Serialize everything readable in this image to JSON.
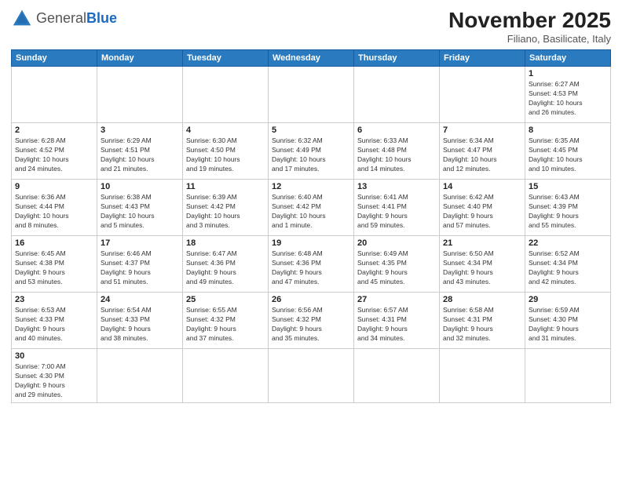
{
  "header": {
    "logo_general": "General",
    "logo_blue": "Blue",
    "month_title": "November 2025",
    "location": "Filiano, Basilicate, Italy"
  },
  "weekdays": [
    "Sunday",
    "Monday",
    "Tuesday",
    "Wednesday",
    "Thursday",
    "Friday",
    "Saturday"
  ],
  "weeks": [
    [
      {
        "day": "",
        "info": ""
      },
      {
        "day": "",
        "info": ""
      },
      {
        "day": "",
        "info": ""
      },
      {
        "day": "",
        "info": ""
      },
      {
        "day": "",
        "info": ""
      },
      {
        "day": "",
        "info": ""
      },
      {
        "day": "1",
        "info": "Sunrise: 6:27 AM\nSunset: 4:53 PM\nDaylight: 10 hours\nand 26 minutes."
      }
    ],
    [
      {
        "day": "2",
        "info": "Sunrise: 6:28 AM\nSunset: 4:52 PM\nDaylight: 10 hours\nand 24 minutes."
      },
      {
        "day": "3",
        "info": "Sunrise: 6:29 AM\nSunset: 4:51 PM\nDaylight: 10 hours\nand 21 minutes."
      },
      {
        "day": "4",
        "info": "Sunrise: 6:30 AM\nSunset: 4:50 PM\nDaylight: 10 hours\nand 19 minutes."
      },
      {
        "day": "5",
        "info": "Sunrise: 6:32 AM\nSunset: 4:49 PM\nDaylight: 10 hours\nand 17 minutes."
      },
      {
        "day": "6",
        "info": "Sunrise: 6:33 AM\nSunset: 4:48 PM\nDaylight: 10 hours\nand 14 minutes."
      },
      {
        "day": "7",
        "info": "Sunrise: 6:34 AM\nSunset: 4:47 PM\nDaylight: 10 hours\nand 12 minutes."
      },
      {
        "day": "8",
        "info": "Sunrise: 6:35 AM\nSunset: 4:45 PM\nDaylight: 10 hours\nand 10 minutes."
      }
    ],
    [
      {
        "day": "9",
        "info": "Sunrise: 6:36 AM\nSunset: 4:44 PM\nDaylight: 10 hours\nand 8 minutes."
      },
      {
        "day": "10",
        "info": "Sunrise: 6:38 AM\nSunset: 4:43 PM\nDaylight: 10 hours\nand 5 minutes."
      },
      {
        "day": "11",
        "info": "Sunrise: 6:39 AM\nSunset: 4:42 PM\nDaylight: 10 hours\nand 3 minutes."
      },
      {
        "day": "12",
        "info": "Sunrise: 6:40 AM\nSunset: 4:42 PM\nDaylight: 10 hours\nand 1 minute."
      },
      {
        "day": "13",
        "info": "Sunrise: 6:41 AM\nSunset: 4:41 PM\nDaylight: 9 hours\nand 59 minutes."
      },
      {
        "day": "14",
        "info": "Sunrise: 6:42 AM\nSunset: 4:40 PM\nDaylight: 9 hours\nand 57 minutes."
      },
      {
        "day": "15",
        "info": "Sunrise: 6:43 AM\nSunset: 4:39 PM\nDaylight: 9 hours\nand 55 minutes."
      }
    ],
    [
      {
        "day": "16",
        "info": "Sunrise: 6:45 AM\nSunset: 4:38 PM\nDaylight: 9 hours\nand 53 minutes."
      },
      {
        "day": "17",
        "info": "Sunrise: 6:46 AM\nSunset: 4:37 PM\nDaylight: 9 hours\nand 51 minutes."
      },
      {
        "day": "18",
        "info": "Sunrise: 6:47 AM\nSunset: 4:36 PM\nDaylight: 9 hours\nand 49 minutes."
      },
      {
        "day": "19",
        "info": "Sunrise: 6:48 AM\nSunset: 4:36 PM\nDaylight: 9 hours\nand 47 minutes."
      },
      {
        "day": "20",
        "info": "Sunrise: 6:49 AM\nSunset: 4:35 PM\nDaylight: 9 hours\nand 45 minutes."
      },
      {
        "day": "21",
        "info": "Sunrise: 6:50 AM\nSunset: 4:34 PM\nDaylight: 9 hours\nand 43 minutes."
      },
      {
        "day": "22",
        "info": "Sunrise: 6:52 AM\nSunset: 4:34 PM\nDaylight: 9 hours\nand 42 minutes."
      }
    ],
    [
      {
        "day": "23",
        "info": "Sunrise: 6:53 AM\nSunset: 4:33 PM\nDaylight: 9 hours\nand 40 minutes."
      },
      {
        "day": "24",
        "info": "Sunrise: 6:54 AM\nSunset: 4:33 PM\nDaylight: 9 hours\nand 38 minutes."
      },
      {
        "day": "25",
        "info": "Sunrise: 6:55 AM\nSunset: 4:32 PM\nDaylight: 9 hours\nand 37 minutes."
      },
      {
        "day": "26",
        "info": "Sunrise: 6:56 AM\nSunset: 4:32 PM\nDaylight: 9 hours\nand 35 minutes."
      },
      {
        "day": "27",
        "info": "Sunrise: 6:57 AM\nSunset: 4:31 PM\nDaylight: 9 hours\nand 34 minutes."
      },
      {
        "day": "28",
        "info": "Sunrise: 6:58 AM\nSunset: 4:31 PM\nDaylight: 9 hours\nand 32 minutes."
      },
      {
        "day": "29",
        "info": "Sunrise: 6:59 AM\nSunset: 4:30 PM\nDaylight: 9 hours\nand 31 minutes."
      }
    ],
    [
      {
        "day": "30",
        "info": "Sunrise: 7:00 AM\nSunset: 4:30 PM\nDaylight: 9 hours\nand 29 minutes."
      },
      {
        "day": "",
        "info": ""
      },
      {
        "day": "",
        "info": ""
      },
      {
        "day": "",
        "info": ""
      },
      {
        "day": "",
        "info": ""
      },
      {
        "day": "",
        "info": ""
      },
      {
        "day": "",
        "info": ""
      }
    ]
  ]
}
